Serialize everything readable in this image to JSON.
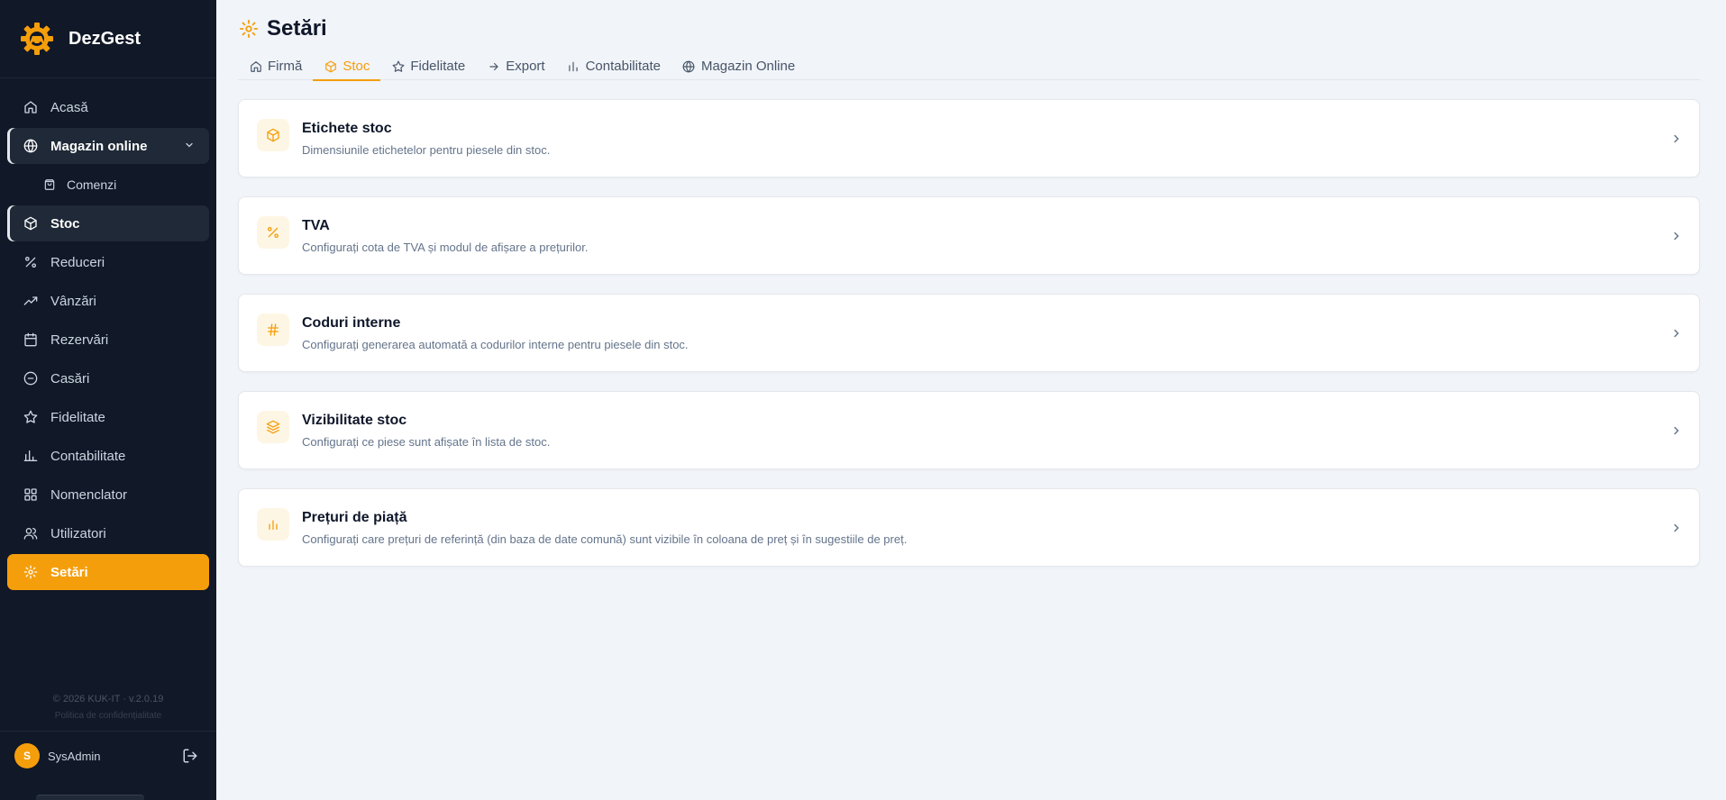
{
  "app": {
    "name": "DezGest"
  },
  "sidebar": {
    "items": [
      {
        "label": "Acasă",
        "icon": "home-icon"
      },
      {
        "label": "Magazin online",
        "icon": "globe-icon"
      },
      {
        "label": "Comenzi",
        "icon": "shopping-bag-icon"
      },
      {
        "label": "Stoc",
        "icon": "box-icon"
      },
      {
        "label": "Reduceri",
        "icon": "percent-icon"
      },
      {
        "label": "Vânzări",
        "icon": "trending-up-icon"
      },
      {
        "label": "Rezervări",
        "icon": "calendar-icon"
      },
      {
        "label": "Casări",
        "icon": "minus-circle-icon"
      },
      {
        "label": "Fidelitate",
        "icon": "star-icon"
      },
      {
        "label": "Contabilitate",
        "icon": "bar-chart-icon"
      },
      {
        "label": "Nomenclator",
        "icon": "grid-icon"
      },
      {
        "label": "Utilizatori",
        "icon": "users-icon"
      },
      {
        "label": "Setări",
        "icon": "gear-icon"
      }
    ],
    "footer": {
      "copyright": "© 2026 KUK-IT · v.2.0.19",
      "policy": "Politica de confidențialitate"
    },
    "user": {
      "initial": "S",
      "name": "SysAdmin"
    }
  },
  "page": {
    "title": "Setări"
  },
  "tabs": [
    {
      "label": "Firmă",
      "icon": "home-icon"
    },
    {
      "label": "Stoc",
      "icon": "box-icon"
    },
    {
      "label": "Fidelitate",
      "icon": "star-icon"
    },
    {
      "label": "Export",
      "icon": "arrow-right-icon"
    },
    {
      "label": "Contabilitate",
      "icon": "bar-chart-icon"
    },
    {
      "label": "Magazin Online",
      "icon": "globe-icon"
    }
  ],
  "cards": [
    {
      "title": "Etichete stoc",
      "description": "Dimensiunile etichetelor pentru piesele din stoc.",
      "icon": "box-icon"
    },
    {
      "title": "TVA",
      "description": "Configurați cota de TVA și modul de afișare a prețurilor.",
      "icon": "percent-icon"
    },
    {
      "title": "Coduri interne",
      "description": "Configurați generarea automată a codurilor interne pentru piesele din stoc.",
      "icon": "hash-icon"
    },
    {
      "title": "Vizibilitate stoc",
      "description": "Configurați ce piese sunt afișate în lista de stoc.",
      "icon": "layers-icon"
    },
    {
      "title": "Prețuri de piață",
      "description": "Configurați care prețuri de referință (din baza de date comună) sunt vizibile în coloana de preț și în sugestiile de preț.",
      "icon": "bar-chart-icon"
    }
  ],
  "colors": {
    "accent": "#f59e0b",
    "sidebar_bg": "#111827",
    "page_bg": "#f1f4f8"
  }
}
